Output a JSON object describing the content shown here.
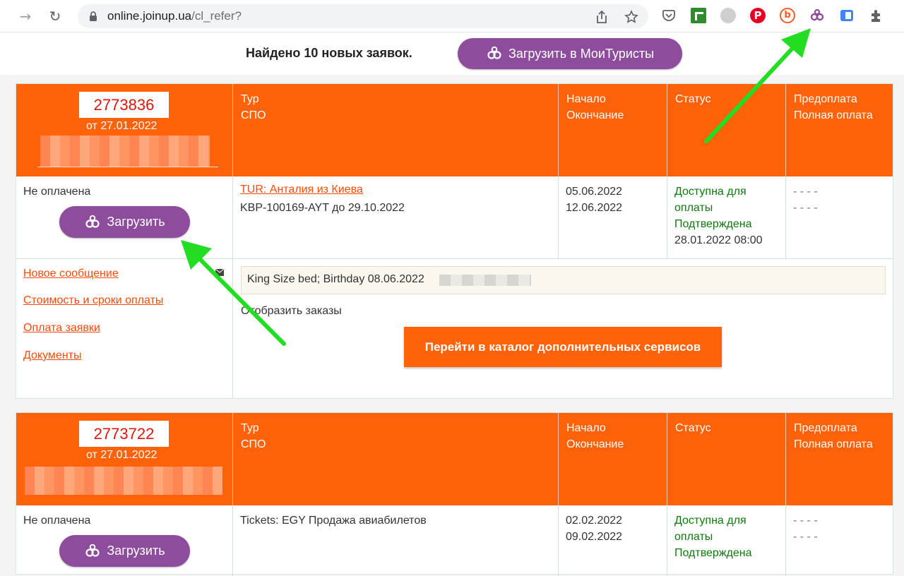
{
  "browser": {
    "url_host": "online.joinup.ua",
    "url_path": "/cl_refer?"
  },
  "notice": {
    "text": "Найдено 10 новых заявок.",
    "upload_all_label": "Загрузить в МоиТуристы"
  },
  "headers": {
    "tour": [
      "Тур",
      "СПО"
    ],
    "dates": [
      "Начало",
      "Окончание"
    ],
    "status": "Статус",
    "payment": [
      "Предоплата",
      "Полная оплата"
    ]
  },
  "orders": [
    {
      "number": "2773836",
      "date": "от 27.01.2022",
      "payment_state": "Не оплачена",
      "upload_label": "Загрузить",
      "tour_link": "TUR: Анталия из Киева",
      "spo": "KBP-100169-AYT до 29.10.2022",
      "start": "05.06.2022",
      "end": "12.06.2022",
      "status_lines": [
        "Доступна для",
        "оплаты",
        "Подтверждена"
      ],
      "status_time": "28.01.2022 08:00",
      "prepay": "- - - -",
      "fullpay": "- - - -",
      "links": [
        "Новое сообщение",
        "Стоимость и сроки оплаты",
        "Оплата заявки",
        "Документы"
      ],
      "note": "King Size bed; Birthday 08.06.2022",
      "show_orders": "Отобразить заказы",
      "catalog_button": "Перейти в каталог дополнительных сервисов"
    },
    {
      "number": "2773722",
      "date": "от 27.01.2022",
      "payment_state": "Не оплачена",
      "upload_label": "Загрузить",
      "tour_text": "Tickets: EGY Продажа авиабилетов",
      "start": "02.02.2022",
      "end": "09.02.2022",
      "status_lines": [
        "Доступна для",
        "оплаты",
        "Подтверждена"
      ],
      "prepay": "- - - -",
      "fullpay": "- - - -"
    }
  ],
  "colors": {
    "accent_orange": "#ff6208",
    "purple": "#8e4c9c",
    "arrow_green": "#22dd22"
  }
}
